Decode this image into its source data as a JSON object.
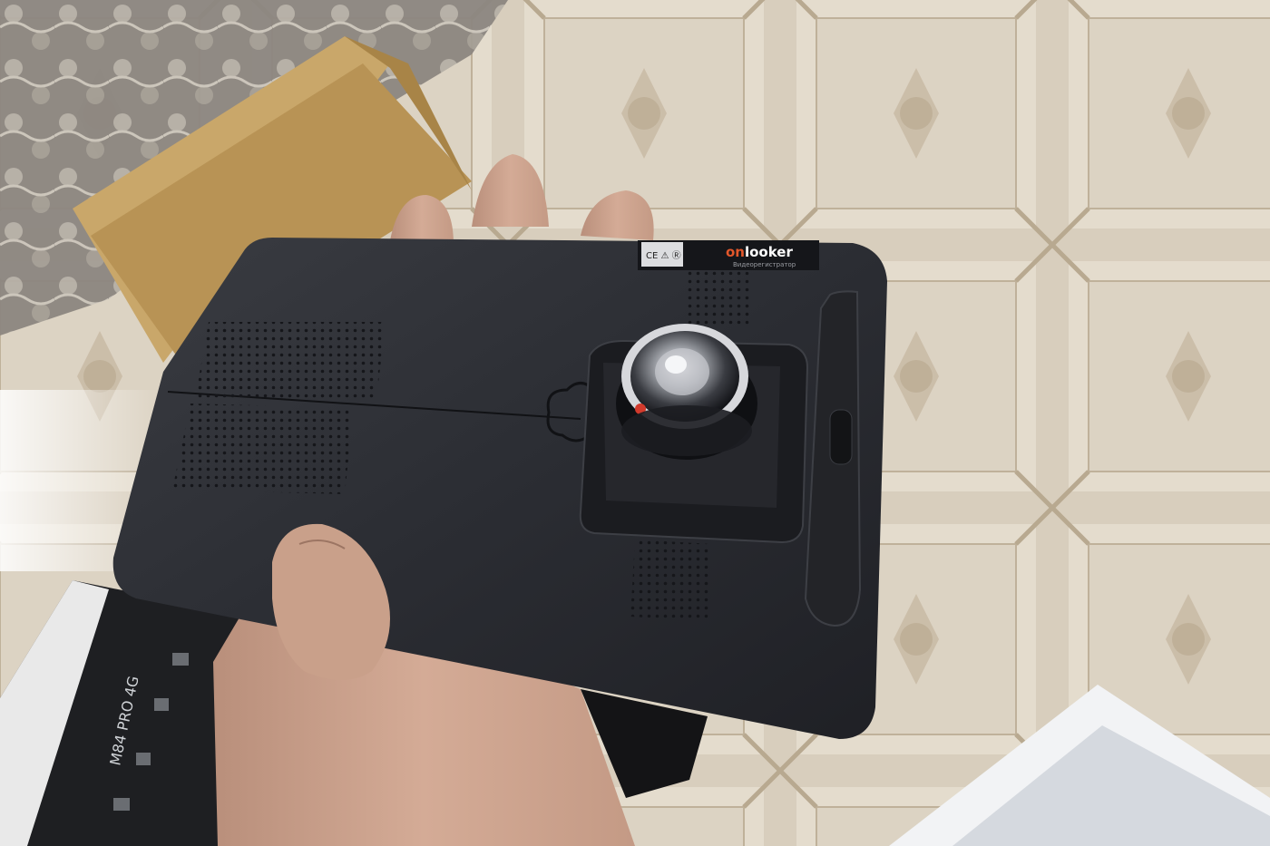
{
  "device": {
    "brand_prefix": "on",
    "brand_suffix": "looker",
    "brand_subtitle": "Видеорегистратор",
    "certification_marks": "CE ⚠ Ⓡ"
  },
  "box": {
    "model_text": "M84 PRO 4G"
  },
  "colors": {
    "device_body": "#2e3036",
    "brand_accent": "#e2572b",
    "floor_base": "#d9cfc0",
    "cardboard": "#c9a76a",
    "skin": "#c9a08a"
  }
}
